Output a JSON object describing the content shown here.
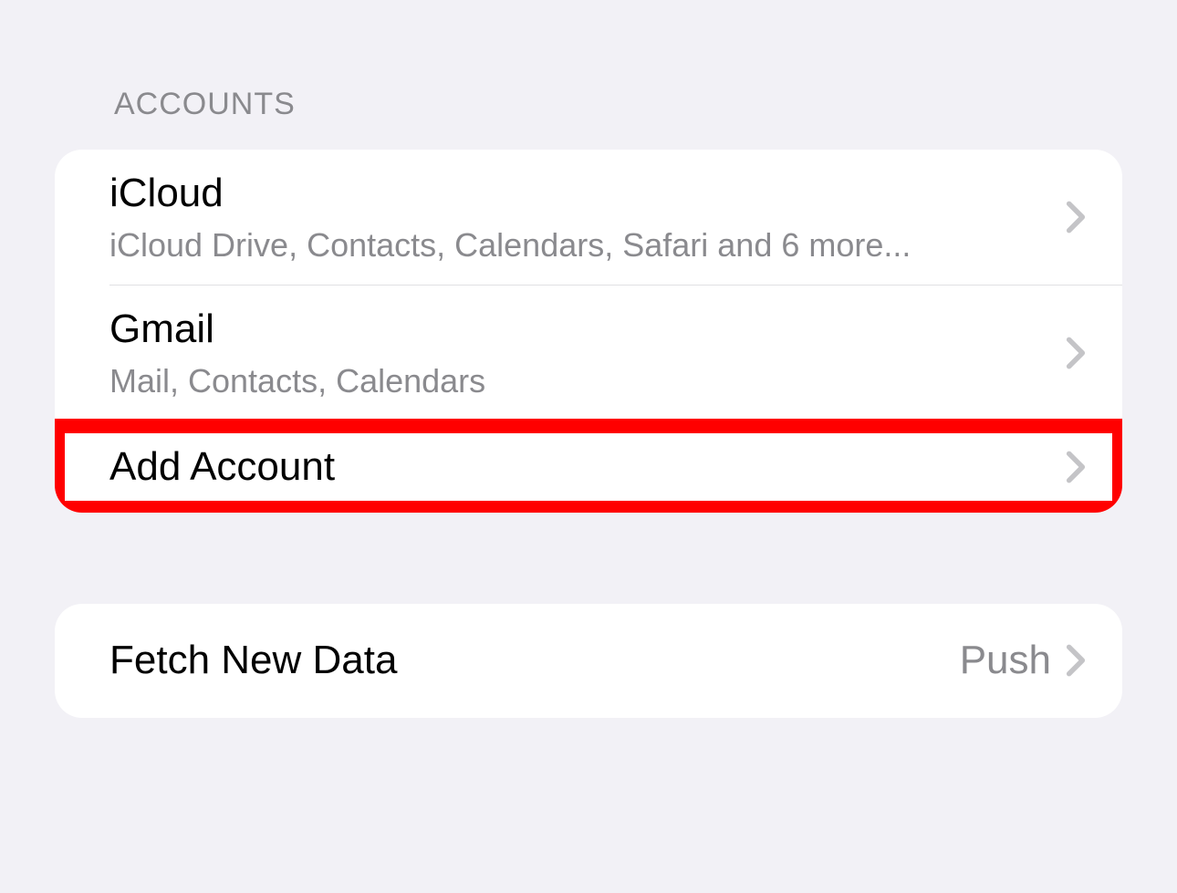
{
  "sections": {
    "accounts": {
      "header": "ACCOUNTS",
      "items": [
        {
          "title": "iCloud",
          "subtitle": "iCloud Drive, Contacts, Calendars, Safari and 6 more..."
        },
        {
          "title": "Gmail",
          "subtitle": "Mail, Contacts, Calendars"
        },
        {
          "title": "Add Account"
        }
      ]
    },
    "fetch": {
      "title": "Fetch New Data",
      "value": "Push"
    }
  }
}
